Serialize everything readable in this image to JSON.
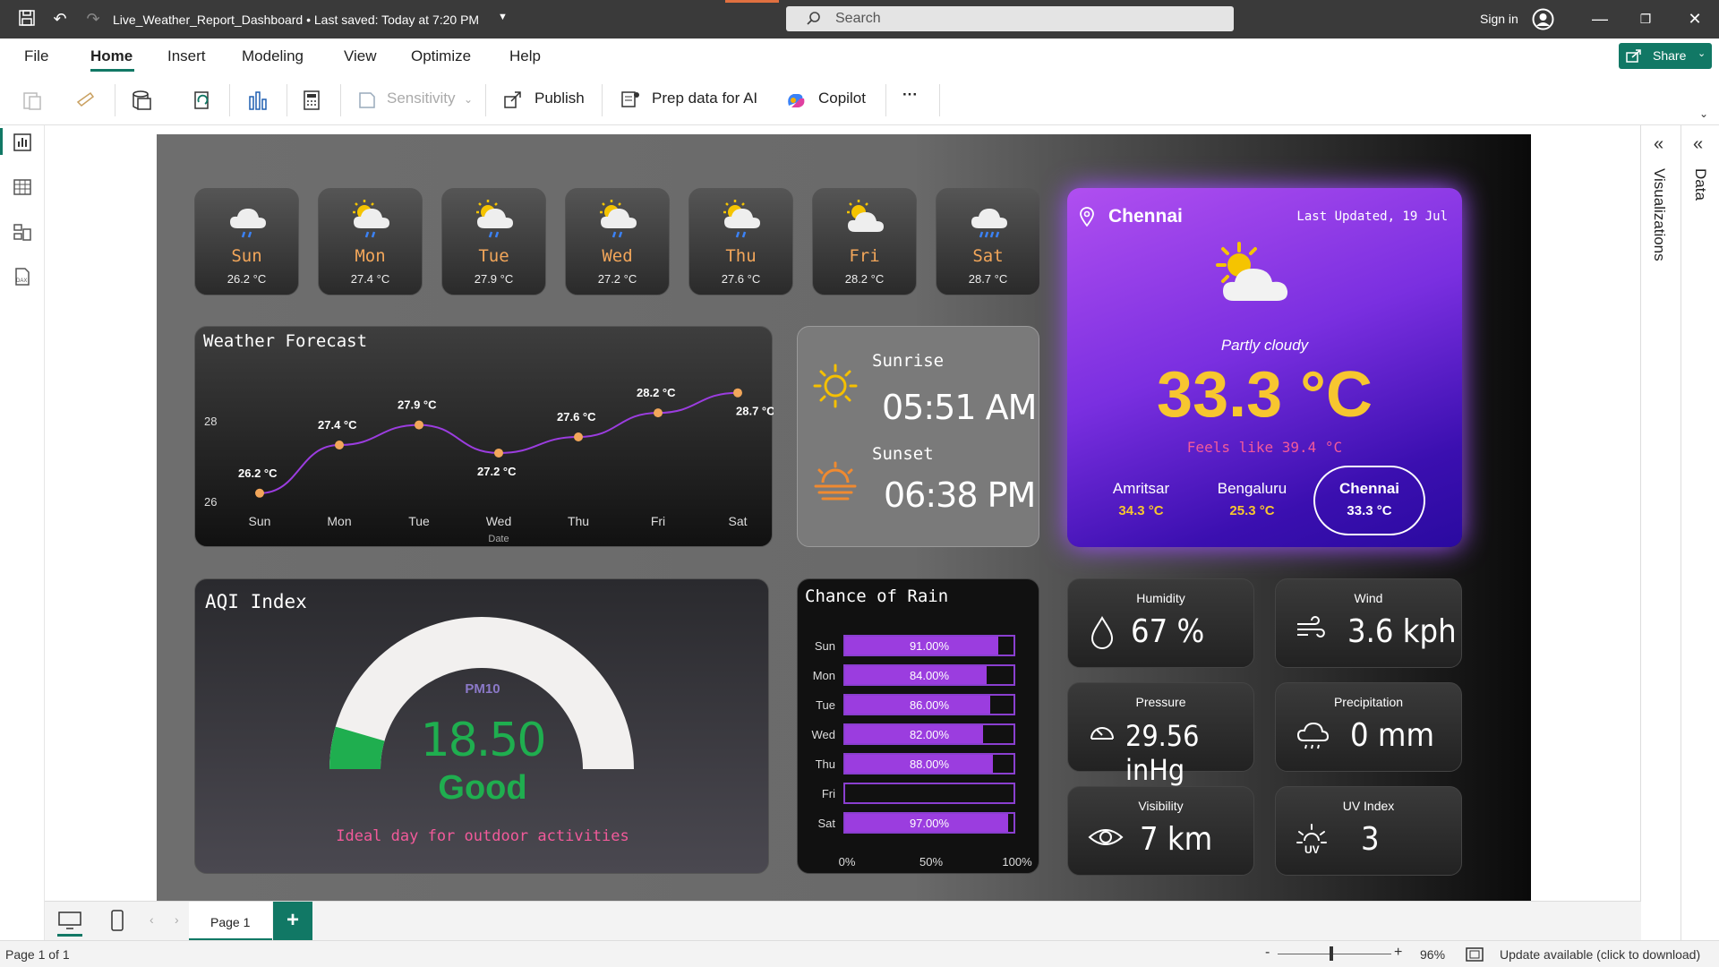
{
  "app": {
    "doc_title": "Live_Weather_Report_Dashboard • Last saved: Today at 7:20 PM",
    "search_placeholder": "Search",
    "sign_in": "Sign in",
    "menu": [
      "File",
      "Home",
      "Insert",
      "Modeling",
      "View",
      "Optimize",
      "Help"
    ],
    "share": "Share",
    "toolbar": {
      "sensitivity": "Sensitivity",
      "publish": "Publish",
      "prep": "Prep data for AI",
      "copilot": "Copilot",
      "more": "···"
    },
    "right_tabs": {
      "visualizations": "Visualizations",
      "data": "Data"
    },
    "page_tab": "Page 1",
    "status_left": "Page 1 of 1",
    "zoom": "96%",
    "update": "Update available (click to download)",
    "colors": {
      "accent": "#117865",
      "title_bar": "#3a3a3a"
    }
  },
  "days": [
    {
      "name": "Sun",
      "temp": "26.2 °C",
      "icon": "rain-cloud-icon"
    },
    {
      "name": "Mon",
      "temp": "27.4 °C",
      "icon": "sun-rain-cloud-icon"
    },
    {
      "name": "Tue",
      "temp": "27.9 °C",
      "icon": "sun-rain-cloud-icon"
    },
    {
      "name": "Wed",
      "temp": "27.2 °C",
      "icon": "sun-rain-cloud-icon"
    },
    {
      "name": "Thu",
      "temp": "27.6 °C",
      "icon": "sun-rain-cloud-icon"
    },
    {
      "name": "Fri",
      "temp": "28.2 °C",
      "icon": "partly-cloudy-icon"
    },
    {
      "name": "Sat",
      "temp": "28.7 °C",
      "icon": "heavy-rain-cloud-icon"
    }
  ],
  "forecast": {
    "title": "Weather Forecast",
    "chart_data": {
      "type": "line",
      "title": "Weather Forecast",
      "xlabel": "Date",
      "categories": [
        "Sun",
        "Mon",
        "Tue",
        "Wed",
        "Thu",
        "Fri",
        "Sat"
      ],
      "values": [
        26.2,
        27.4,
        27.9,
        27.2,
        27.6,
        28.2,
        28.7
      ],
      "data_labels": [
        "26.2 °C",
        "27.4 °C",
        "27.9 °C",
        "27.2 °C",
        "27.6 °C",
        "28.2 °C",
        "28.7 °C"
      ],
      "y_ticks": [
        "26",
        "28"
      ],
      "ylim": [
        25.95,
        29.05
      ],
      "line_color": "#9b3ddf",
      "marker_color": "#f2a65a"
    }
  },
  "sun": {
    "sunrise_label": "Sunrise",
    "sunrise": "05:51 AM",
    "sunset_label": "Sunset",
    "sunset": "06:38 PM"
  },
  "city": {
    "name": "Chennai",
    "updated": "Last Updated, 19 Jul",
    "condition": "Partly cloudy",
    "temp": "33.3 °C",
    "feels": "Feels like 39.4 °C",
    "others": [
      {
        "name": "Amritsar",
        "temp": "34.3 °C"
      },
      {
        "name": "Bengaluru",
        "temp": "25.3 °C"
      },
      {
        "name": "Chennai",
        "temp": "33.3 °C"
      }
    ]
  },
  "aqi": {
    "title": "AQI Index",
    "pollutant": "PM10",
    "value": "18.50",
    "level": "Good",
    "fraction": 0.09,
    "note": "Ideal day for outdoor activities"
  },
  "rain": {
    "title": "Chance of Rain",
    "chart_data": {
      "type": "bar",
      "title": "Chance of Rain",
      "categories": [
        "Sun",
        "Mon",
        "Tue",
        "Wed",
        "Thu",
        "Fri",
        "Sat"
      ],
      "values": [
        91,
        84,
        86,
        82,
        88,
        0,
        97
      ],
      "labels": [
        "91.00%",
        "84.00%",
        "86.00%",
        "82.00%",
        "88.00%",
        "",
        "97.00%"
      ],
      "x_ticks": [
        "0%",
        "50%",
        "100%"
      ],
      "xlim": [
        0,
        100
      ]
    }
  },
  "stats": {
    "humidity": {
      "label": "Humidity",
      "value": "67 %"
    },
    "wind": {
      "label": "Wind",
      "value": "3.6 kph"
    },
    "pressure": {
      "label": "Pressure",
      "value": "29.56 inHg"
    },
    "precipitation": {
      "label": "Precipitation",
      "value": "0 mm"
    },
    "visibility": {
      "label": "Visibility",
      "value": "7 km"
    },
    "uv": {
      "label": "UV Index",
      "value": "3"
    }
  }
}
